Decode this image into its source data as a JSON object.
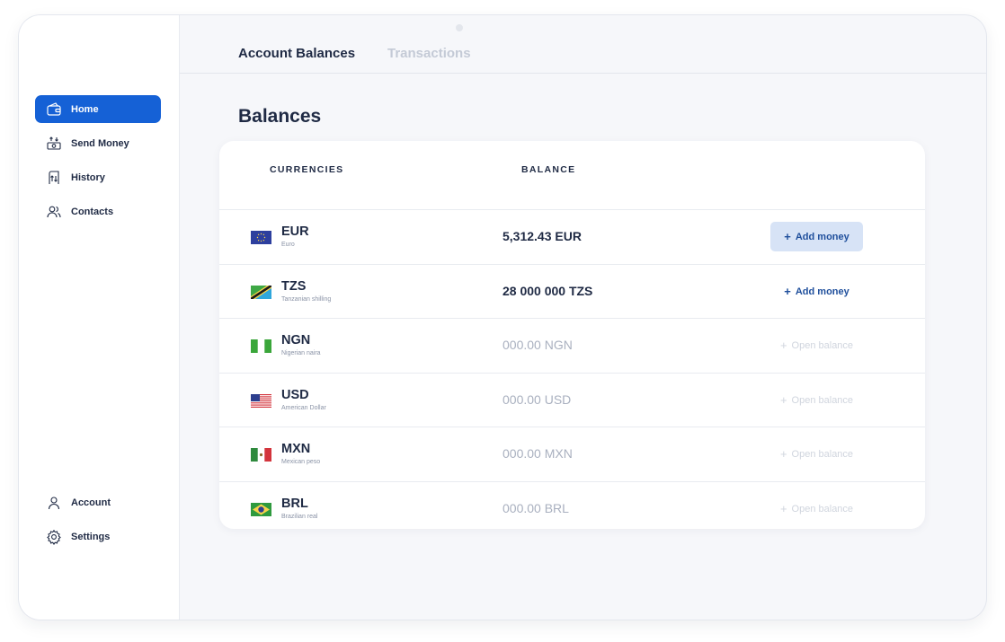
{
  "sidebar": {
    "nav": [
      {
        "label": "Home",
        "icon": "wallet-icon",
        "active": true
      },
      {
        "label": "Send Money",
        "icon": "send-money-icon",
        "active": false
      },
      {
        "label": "History",
        "icon": "history-icon",
        "active": false
      },
      {
        "label": "Contacts",
        "icon": "contacts-icon",
        "active": false
      }
    ],
    "bottom": [
      {
        "label": "Account",
        "icon": "user-icon"
      },
      {
        "label": "Settings",
        "icon": "gear-icon"
      }
    ]
  },
  "tabs": [
    {
      "label": "Account Balances",
      "active": true
    },
    {
      "label": "Transactions",
      "active": false
    }
  ],
  "page_title": "Balances",
  "table": {
    "headers": {
      "currencies": "CURRENCIES",
      "balance": "BALANCE"
    },
    "rows": [
      {
        "code": "EUR",
        "name": "Euro",
        "flag": "eu-flag-icon",
        "balance": "5,312.43 EUR",
        "has_balance": true,
        "action": "Add money",
        "action_style": "primary"
      },
      {
        "code": "TZS",
        "name": "Tanzanian shilling",
        "flag": "tanzania-flag-icon",
        "balance": "28 000 000 TZS",
        "has_balance": true,
        "action": "Add money",
        "action_style": "link"
      },
      {
        "code": "NGN",
        "name": "Nigerian naira",
        "flag": "nigeria-flag-icon",
        "balance": "000.00 NGN",
        "has_balance": false,
        "action": "Open balance",
        "action_style": "disabled"
      },
      {
        "code": "USD",
        "name": "American Dollar",
        "flag": "usa-flag-icon",
        "balance": "000.00 USD",
        "has_balance": false,
        "action": "Open balance",
        "action_style": "disabled"
      },
      {
        "code": "MXN",
        "name": "Mexican peso",
        "flag": "mexico-flag-icon",
        "balance": "000.00 MXN",
        "has_balance": false,
        "action": "Open balance",
        "action_style": "disabled"
      },
      {
        "code": "BRL",
        "name": "Brazilian real",
        "flag": "brazil-flag-icon",
        "balance": "000.00 BRL",
        "has_balance": false,
        "action": "Open balance",
        "action_style": "disabled"
      }
    ]
  },
  "colors": {
    "accent": "#1561d6",
    "text_dark": "#1f2a44",
    "muted": "#a9b0bf",
    "button_bg": "#d7e3f6"
  }
}
